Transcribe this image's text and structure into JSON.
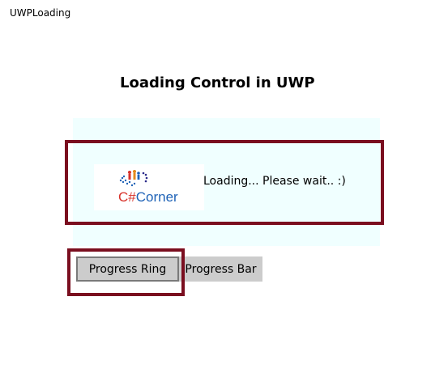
{
  "window": {
    "title": "UWPLoading"
  },
  "main": {
    "heading": "Loading Control in UWP",
    "loading_text": "Loading... Please wait.. :)",
    "logo_text": {
      "part1": "C#",
      "part2": "Corner"
    }
  },
  "buttons": {
    "progress_ring_label": "Progress Ring",
    "progress_bar_label": "Progress Bar"
  },
  "colors": {
    "highlight": "#7a0e1f",
    "panel_background": "#f0ffff",
    "button_background": "#cccccc",
    "logo_red": "#d8322a",
    "logo_blue": "#1f63b7"
  }
}
